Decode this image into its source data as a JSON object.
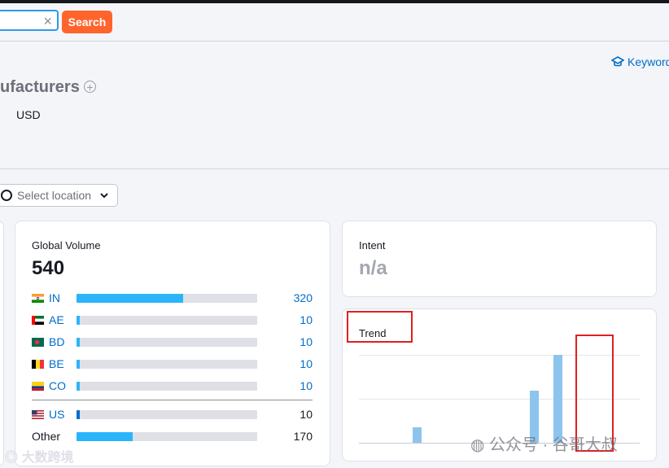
{
  "search": {
    "value": "",
    "clear_glyph": "×",
    "button_label": "Search"
  },
  "header": {
    "link_icon": "graduation-cap-icon",
    "link_label": "Keyword",
    "title": "ufacturers",
    "currency": "USD"
  },
  "location_select": {
    "placeholder": "Select location"
  },
  "global_volume": {
    "label": "Global Volume",
    "value": "540",
    "countries": [
      {
        "code": "IN",
        "flag": "india-flag-icon",
        "value": "320",
        "share": 0.59
      },
      {
        "code": "AE",
        "flag": "uae-flag-icon",
        "value": "10",
        "share": 0.02
      },
      {
        "code": "BD",
        "flag": "bangladesh-flag-icon",
        "value": "10",
        "share": 0.02
      },
      {
        "code": "BE",
        "flag": "belgium-flag-icon",
        "value": "10",
        "share": 0.02
      },
      {
        "code": "CO",
        "flag": "colombia-flag-icon",
        "value": "10",
        "share": 0.02
      }
    ],
    "us": {
      "code": "US",
      "flag": "us-flag-icon",
      "value": "10",
      "share": 0.02
    },
    "other": {
      "label": "Other",
      "value": "170",
      "share": 0.31
    }
  },
  "intent": {
    "label": "Intent",
    "value": "n/a"
  },
  "trend": {
    "label": "Trend",
    "values": [
      0,
      0,
      0.18,
      0,
      0,
      0,
      0,
      0.59,
      1.0,
      0,
      0,
      0
    ]
  },
  "watermarks": {
    "wechat": "公众号 · 谷哥大叔",
    "corner": "大数跨境"
  },
  "colors": {
    "accent": "#ff642d",
    "link": "#006dca",
    "bar": "#2cb4fb",
    "trend_bar": "#8cc4ee",
    "annotation": "#e02020"
  }
}
